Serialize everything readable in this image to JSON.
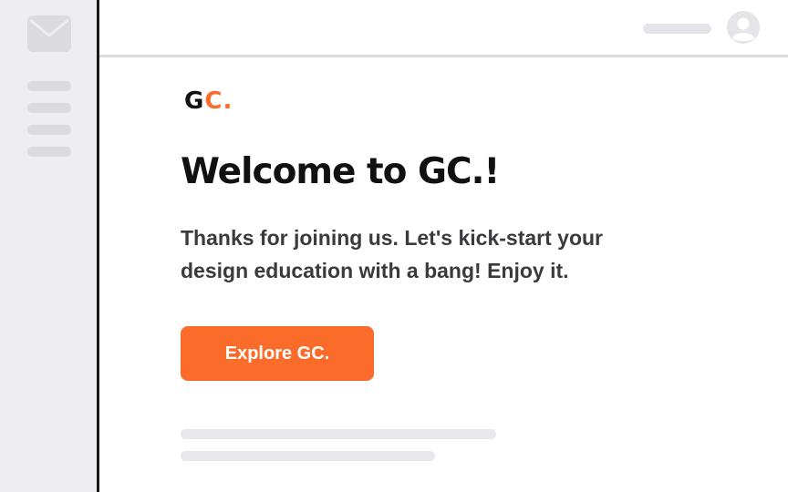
{
  "sidebar": {
    "mail_icon": "mail-icon",
    "menu_items": 4
  },
  "topbar": {
    "avatar_icon": "user-avatar-icon"
  },
  "email": {
    "logo_letter_1": "G",
    "logo_letter_2": "C",
    "logo_dot": ".",
    "title": "Welcome to GC.!",
    "body": "Thanks for joining us. Let's kick-start your design education with a bang! Enjoy it.",
    "cta_label": "Explore GC."
  },
  "colors": {
    "accent": "#fb6c2a",
    "sidebar_bg": "#eeeef1",
    "text_dark": "#111111",
    "text_body": "#3a3a3f",
    "placeholder": "#e8e8ec"
  }
}
